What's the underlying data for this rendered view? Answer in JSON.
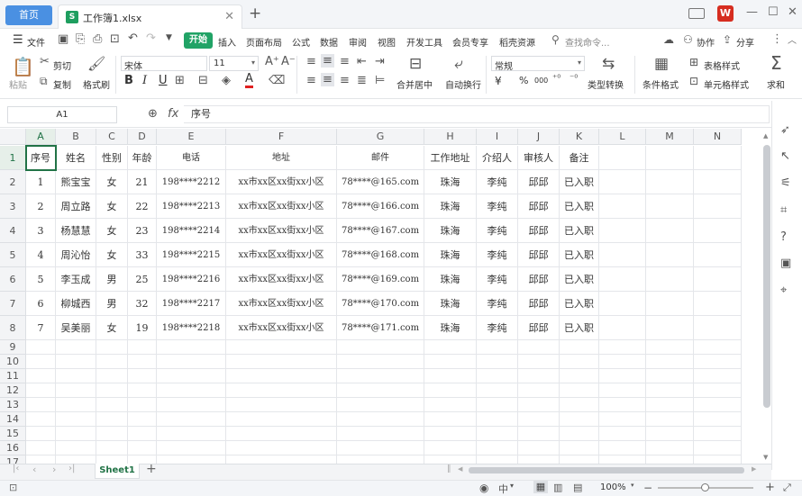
{
  "titlebar": {
    "home_tab": "首页",
    "file_icon": "S",
    "file_name": "工作簿1.xlsx",
    "close_tab": "✕",
    "new_tab": "+",
    "brand_logo": "W"
  },
  "menubar": {
    "file": "文件",
    "tabs": [
      "开始",
      "插入",
      "页面布局",
      "公式",
      "数据",
      "审阅",
      "视图",
      "开发工具",
      "会员专享",
      "稻壳资源"
    ],
    "search_placeholder": "查找命令...",
    "collaborate": "协作",
    "share": "分享"
  },
  "ribbon": {
    "paste": "粘贴",
    "cut": "剪切",
    "copy": "复制",
    "format_painter": "格式刷",
    "font_name": "宋体",
    "font_size": "11",
    "bold": "B",
    "italic": "I",
    "underline": "U",
    "merge_center": "合并居中",
    "wrap_text": "自动换行",
    "number_format": "常规",
    "currency": "¥",
    "percent": "%",
    "thousands": "000",
    "type_convert": "类型转换",
    "conditional_format": "条件格式",
    "table_style": "表格样式",
    "cell_style": "单元格样式",
    "sum": "求和"
  },
  "formula_bar": {
    "name_box": "A1",
    "fx": "fx",
    "formula": "序号"
  },
  "sheet": {
    "columns": [
      "A",
      "B",
      "C",
      "D",
      "E",
      "F",
      "G",
      "H",
      "I",
      "J",
      "K",
      "L",
      "M",
      "N"
    ],
    "row_numbers": [
      "1",
      "2",
      "3",
      "4",
      "5",
      "6",
      "7",
      "8",
      "9",
      "10",
      "11",
      "12",
      "13",
      "14",
      "15",
      "16",
      "17"
    ],
    "rows": [
      [
        "序号",
        "姓名",
        "性别",
        "年龄",
        "电话",
        "地址",
        "邮件",
        "工作地址",
        "介绍人",
        "审核人",
        "备注"
      ],
      [
        "1",
        "熊宝宝",
        "女",
        "21",
        "198****2212",
        "xx市xx区xx街xx小区",
        "78****@165.com",
        "珠海",
        "李纯",
        "邱邱",
        "已入职"
      ],
      [
        "2",
        "周立路",
        "女",
        "22",
        "198****2213",
        "xx市xx区xx街xx小区",
        "78****@166.com",
        "珠海",
        "李纯",
        "邱邱",
        "已入职"
      ],
      [
        "3",
        "杨慧慧",
        "女",
        "23",
        "198****2214",
        "xx市xx区xx街xx小区",
        "78****@167.com",
        "珠海",
        "李纯",
        "邱邱",
        "已入职"
      ],
      [
        "4",
        "周沁怡",
        "女",
        "33",
        "198****2215",
        "xx市xx区xx街xx小区",
        "78****@168.com",
        "珠海",
        "李纯",
        "邱邱",
        "已入职"
      ],
      [
        "5",
        "李玉成",
        "男",
        "25",
        "198****2216",
        "xx市xx区xx街xx小区",
        "78****@169.com",
        "珠海",
        "李纯",
        "邱邱",
        "已入职"
      ],
      [
        "6",
        "柳城西",
        "男",
        "32",
        "198****2217",
        "xx市xx区xx街xx小区",
        "78****@170.com",
        "珠海",
        "李纯",
        "邱邱",
        "已入职"
      ],
      [
        "7",
        "吴美丽",
        "女",
        "19",
        "198****2218",
        "xx市xx区xx街xx小区",
        "78****@171.com",
        "珠海",
        "李纯",
        "邱邱",
        "已入职"
      ]
    ]
  },
  "sheet_tabs": {
    "active": "Sheet1",
    "add": "+"
  },
  "status": {
    "zoom": "100%"
  },
  "colors": {
    "accent_green": "#21a366",
    "selection": "#217346",
    "home_tab": "#4a90e2"
  }
}
